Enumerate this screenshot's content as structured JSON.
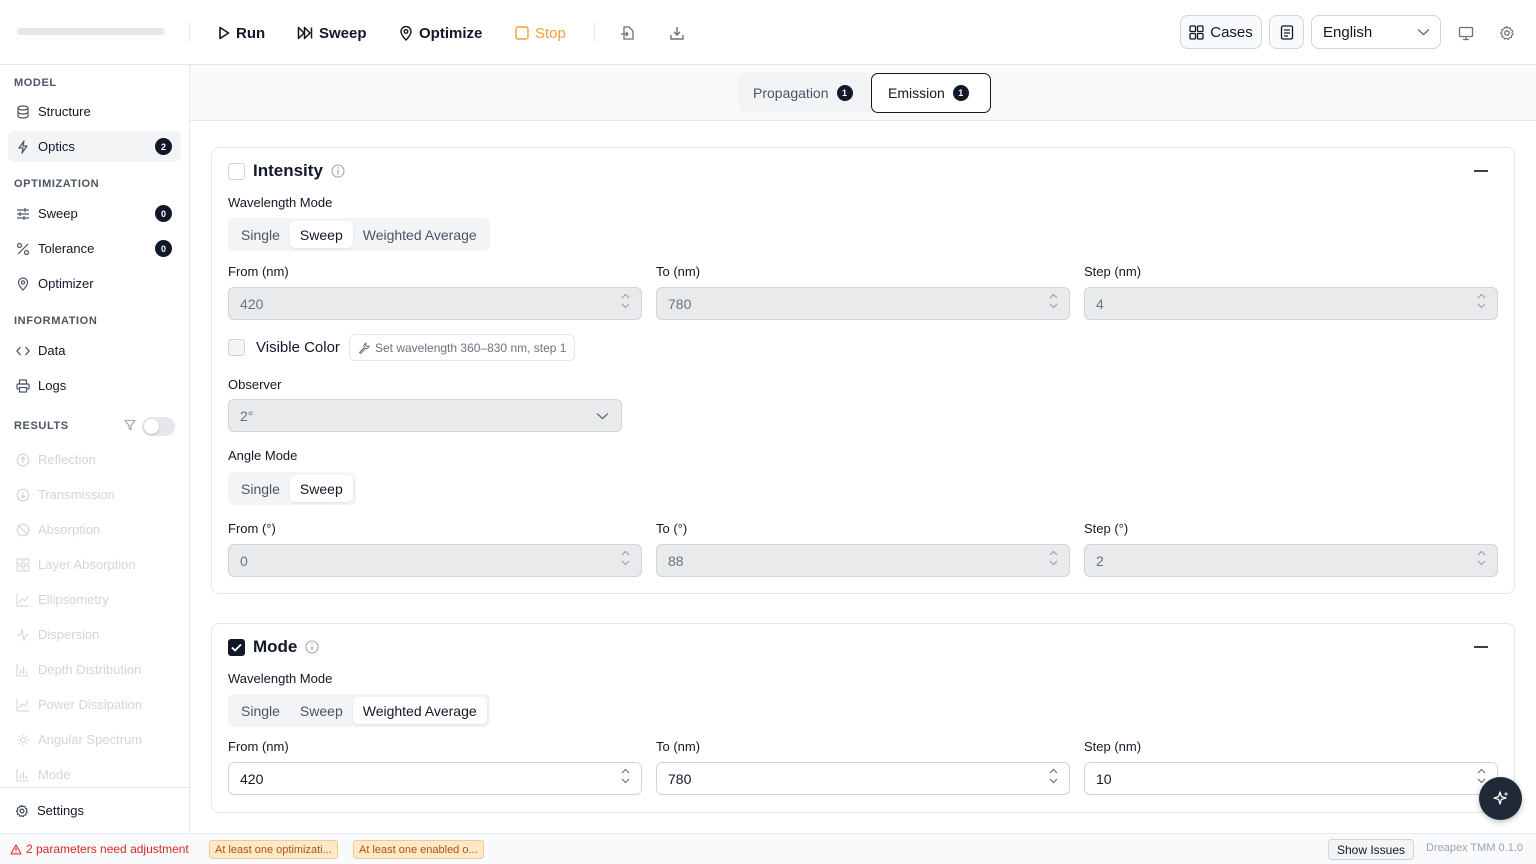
{
  "toolbar": {
    "run_label": "Run",
    "sweep_label": "Sweep",
    "optimize_label": "Optimize",
    "stop_label": "Stop",
    "cases_label": "Cases",
    "language": "English"
  },
  "sidebar": {
    "sections": {
      "model": "MODEL",
      "optimization": "OPTIMIZATION",
      "information": "INFORMATION",
      "results": "RESULTS"
    },
    "model_items": [
      {
        "label": "Structure",
        "icon": "database-icon"
      },
      {
        "label": "Optics",
        "icon": "lightning-icon",
        "badge": "2",
        "active": true
      }
    ],
    "optimization_items": [
      {
        "label": "Sweep",
        "icon": "sliders-icon",
        "badge": "0"
      },
      {
        "label": "Tolerance",
        "icon": "percent-icon",
        "badge": "0"
      },
      {
        "label": "Optimizer",
        "icon": "map-pin-icon"
      }
    ],
    "information_items": [
      {
        "label": "Data",
        "icon": "code-icon"
      },
      {
        "label": "Logs",
        "icon": "printer-icon"
      }
    ],
    "results_items": [
      {
        "label": "Reflection",
        "icon": "arrow-up-circle-icon"
      },
      {
        "label": "Transmission",
        "icon": "arrow-down-circle-icon"
      },
      {
        "label": "Absorption",
        "icon": "ban-icon"
      },
      {
        "label": "Layer Absorption",
        "icon": "grid-icon"
      },
      {
        "label": "Ellipsometry",
        "icon": "line-chart-icon"
      },
      {
        "label": "Dispersion",
        "icon": "activity-icon"
      },
      {
        "label": "Depth Distribution",
        "icon": "bar-chart-icon"
      },
      {
        "label": "Power Dissipation",
        "icon": "line-chart-icon"
      },
      {
        "label": "Angular Spectrum",
        "icon": "sun-icon"
      },
      {
        "label": "Mode",
        "icon": "bar-chart-icon"
      }
    ],
    "settings_label": "Settings"
  },
  "tabs": [
    {
      "label": "Propagation",
      "badge": "1"
    },
    {
      "label": "Emission",
      "badge": "1",
      "active": true
    }
  ],
  "intensity": {
    "title": "Intensity",
    "checked": false,
    "wavelength_mode_label": "Wavelength Mode",
    "wavelength_modes": [
      "Single",
      "Sweep",
      "Weighted Average"
    ],
    "wavelength_mode_selected": "Sweep",
    "from_label": "From (nm)",
    "from_value": "420",
    "to_label": "To (nm)",
    "to_value": "780",
    "step_label": "Step (nm)",
    "step_value": "4",
    "visible_color_label": "Visible Color",
    "set_wavelength_label": "Set wavelength 360–830 nm, step 1",
    "observer_label": "Observer",
    "observer_value": "2°",
    "angle_mode_label": "Angle Mode",
    "angle_modes": [
      "Single",
      "Sweep"
    ],
    "angle_mode_selected": "Sweep",
    "angle_from_label": "From (°)",
    "angle_from_value": "0",
    "angle_to_label": "To (°)",
    "angle_to_value": "88",
    "angle_step_label": "Step (°)",
    "angle_step_value": "2"
  },
  "mode": {
    "title": "Mode",
    "checked": true,
    "wavelength_mode_label": "Wavelength Mode",
    "wavelength_modes": [
      "Single",
      "Sweep",
      "Weighted Average"
    ],
    "wavelength_mode_selected": "Weighted Average",
    "from_label": "From (nm)",
    "from_value": "420",
    "to_label": "To (nm)",
    "to_value": "780",
    "step_label": "Step (nm)",
    "step_value": "10"
  },
  "status": {
    "warning": "2 parameters need adjustment",
    "chips": [
      "At least one optimizati...",
      "At least one enabled o..."
    ],
    "show_issues_label": "Show Issues",
    "version": "Dreapex TMM 0.1.0"
  },
  "colors": {
    "accent": "#111827",
    "stop": "#f59e3a",
    "warning": "#dc2626",
    "chip_bg": "#fde8c8"
  }
}
